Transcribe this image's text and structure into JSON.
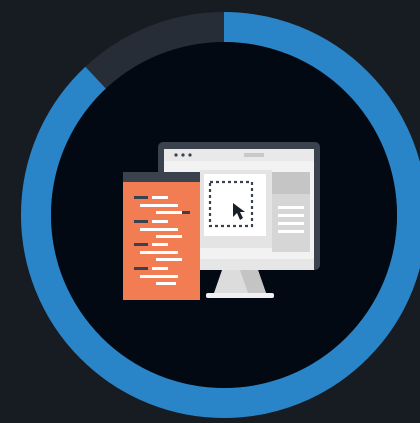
{
  "progress": {
    "fraction": 0.88
  },
  "colors": {
    "background": "#171c23",
    "ring_track": "#272d36",
    "ring_progress": "#2a85c8",
    "inner_disc": "#020912",
    "monitor_frame": "#3a434d",
    "monitor_screen": "#f2f2f2",
    "code_panel": "#f27d53",
    "code_panel_header": "#3a434d"
  },
  "icons": {
    "illustration": "web-development-icon",
    "cursor": "cursor-arrow-icon"
  }
}
